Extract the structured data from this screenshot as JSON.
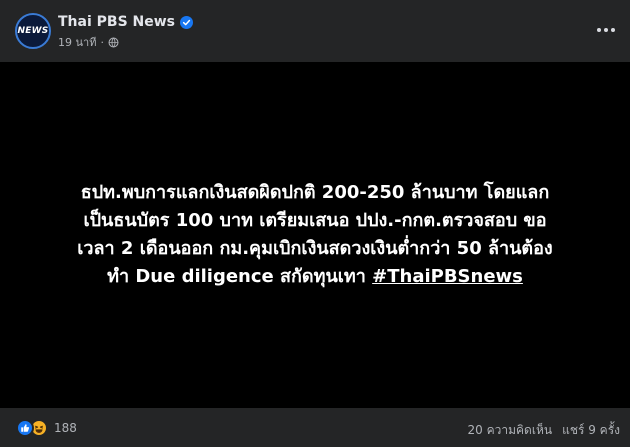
{
  "header": {
    "avatar_text": "NEWS",
    "page_name": "Thai PBS News",
    "time": "19 นาที",
    "separator": "·"
  },
  "post": {
    "lines": [
      "ธปท.พบการแลกเงินสดผิดปกติ 200-250 ล้านบาท โดยแลก",
      "เป็นธนบัตร 100 บาท เตรียมเสนอ ปปง.-กกต.ตรวจสอบ ขอ",
      "เวลา 2 เดือนออก กม.คุมเบิกเงินสดวงเงินต่ำกว่า 50 ล้านต้อง",
      "ทำ Due diligence สกัดทุนเทา "
    ],
    "hashtag": "#ThaiPBSnews"
  },
  "footer": {
    "reaction_count": "188",
    "comments": "20 ความคิดเห็น",
    "shares": "แชร์ 9 ครั้ง"
  },
  "colors": {
    "background": "#242526",
    "post_background": "#000000",
    "like_blue": "#1877f2",
    "haha_yellow": "#f7b125",
    "secondary_text": "#b0b3b8"
  },
  "icons": [
    "verified-badge-icon",
    "globe-icon",
    "more-options-icon",
    "like-reaction-icon",
    "haha-reaction-icon"
  ]
}
